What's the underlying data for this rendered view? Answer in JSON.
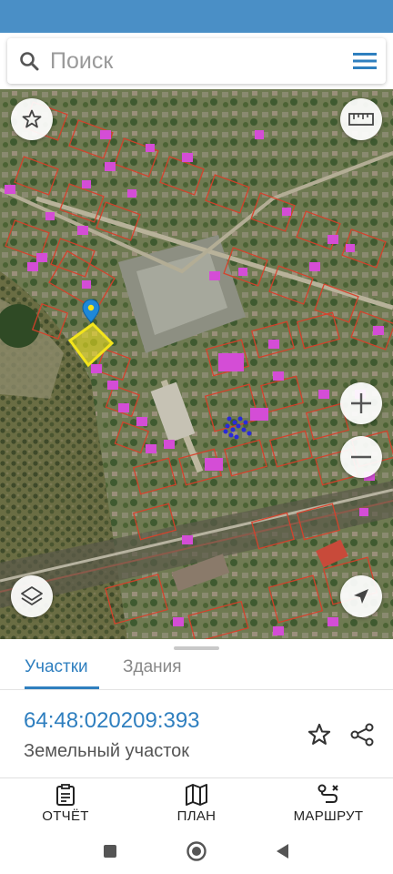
{
  "search": {
    "placeholder": "Поиск",
    "value": ""
  },
  "map": {
    "buttons": {
      "favorite": "star-icon",
      "ruler": "ruler-icon",
      "zoom_in": "plus-icon",
      "zoom_out": "minus-icon",
      "layers": "layers-icon",
      "locate": "navigation-arrow-icon"
    },
    "colors": {
      "parcel_border": "#d8402a",
      "building_fill": "#d44dd6",
      "selected_parcel": "#f4e51c",
      "marker": "#1e88d8"
    }
  },
  "sheet": {
    "tabs": [
      {
        "label": "Участки",
        "active": true
      },
      {
        "label": "Здания",
        "active": false
      }
    ],
    "parcel": {
      "cadastral_number": "64:48:020209:393",
      "type": "Земельный участок"
    }
  },
  "bottom_nav": {
    "items": [
      {
        "label": "ОТЧЁТ",
        "icon": "clipboard-icon"
      },
      {
        "label": "ПЛАН",
        "icon": "map-icon"
      },
      {
        "label": "МАРШРУТ",
        "icon": "route-icon"
      }
    ]
  },
  "system_nav": {
    "recents": "square-icon",
    "home": "circle-icon",
    "back": "triangle-icon"
  },
  "colors": {
    "accent": "#2f7fbf",
    "status_bar": "#4a8fc6"
  }
}
